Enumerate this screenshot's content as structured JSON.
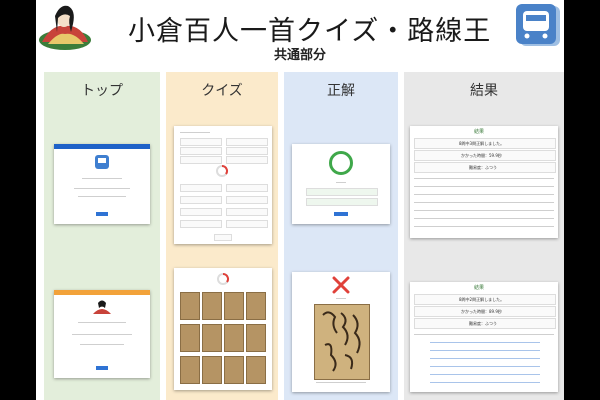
{
  "header": {
    "title": "小倉百人一首クイズ・路線王",
    "subtitle": "共通部分"
  },
  "columns": [
    {
      "label": "トップ"
    },
    {
      "label": "クイズ"
    },
    {
      "label": "正解"
    },
    {
      "label": "結果"
    }
  ],
  "result_screens": {
    "heading": "結果",
    "correct_count_1": "8問中3問正解しました。",
    "time_1": "かかった時間：59.9秒",
    "rank_1": "難易度：ふつう",
    "correct_count_2": "8問中2問正解しました。",
    "time_2": "かかった時間：89.9秒",
    "rank_2": "難易度：ふつう"
  },
  "colors": {
    "top_bg": "#e3eedb",
    "quiz_bg": "#fbeacb",
    "answer_bg": "#dce7f6",
    "result_bg": "#e8e8e8",
    "header_blue": "#1e62c8",
    "header_orange": "#f2a23a",
    "correct_green": "#3fa84a",
    "wrong_red": "#e0413a"
  },
  "icons": [
    "poet-portrait-logo",
    "train-icon",
    "check-circle-icon",
    "cross-icon"
  ]
}
